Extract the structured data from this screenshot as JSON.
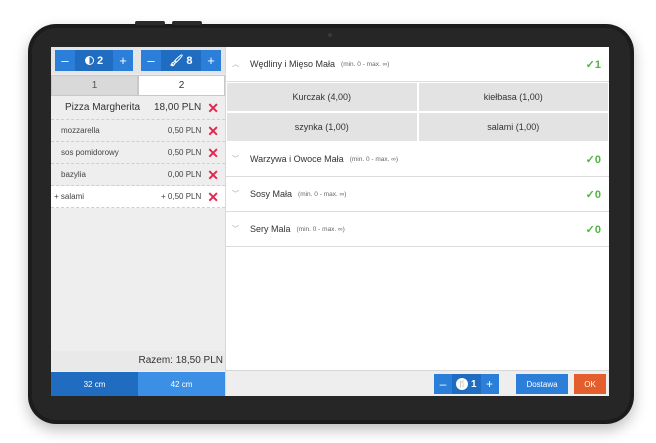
{
  "left_panel": {
    "persons_stepper": {
      "minus": "–",
      "value": "2",
      "plus": "+"
    },
    "portions_stepper": {
      "minus": "–",
      "value": "8",
      "plus": "+"
    },
    "tabs": [
      {
        "label": "1",
        "active": false
      },
      {
        "label": "2",
        "active": true
      }
    ],
    "items": [
      {
        "name": "Pizza Margherita",
        "price": "18,00 PLN",
        "type": "main"
      },
      {
        "name": "mozzarella",
        "price": "0,50 PLN",
        "type": "ingredient"
      },
      {
        "name": "sos pomidorowy",
        "price": "0,50 PLN",
        "type": "ingredient"
      },
      {
        "name": "bazylia",
        "price": "0,00 PLN",
        "type": "ingredient"
      },
      {
        "name": "+ salami",
        "price": "+ 0,50 PLN",
        "type": "added"
      }
    ],
    "total": "Razem: 18,50 PLN",
    "sizes": [
      {
        "label": "32 cm",
        "active": false
      },
      {
        "label": "42 cm",
        "active": true
      }
    ]
  },
  "right_panel": {
    "categories": [
      {
        "name": "Wędliny i Mięso Mała",
        "range": "(min. 0 - max. ∞)",
        "check": "✓1",
        "expanded": true,
        "options": [
          "Kurczak (4,00)",
          "kiełbasa (1,00)",
          "szynka (1,00)",
          "salami (1,00)"
        ]
      },
      {
        "name": "Warzywa i Owoce Mała",
        "range": "(min. 0 - max. ∞)",
        "check": "✓0",
        "expanded": false
      },
      {
        "name": "Sosy Mała",
        "range": "(min. 0 - max. ∞)",
        "check": "✓0",
        "expanded": false
      },
      {
        "name": "Sery Mala",
        "range": "(min. 0 - max. ∞)",
        "check": "✓0",
        "expanded": false
      }
    ],
    "bottom": {
      "qty_minus": "–",
      "qty_value": "1",
      "qty_plus": "+",
      "delivery_label": "Dostawa",
      "ok_label": "OK"
    }
  },
  "icons": [
    "half-circle-icon",
    "brush-icon",
    "delete-x-icon",
    "chevron-up-icon",
    "chevron-down-icon",
    "check-icon",
    "plate-icon"
  ],
  "colors": {
    "primary": "#1f6cc0",
    "primary_light": "#2b7fd8",
    "delete": "#e4264f",
    "check": "#4cb83c",
    "ok": "#e45d2c"
  }
}
